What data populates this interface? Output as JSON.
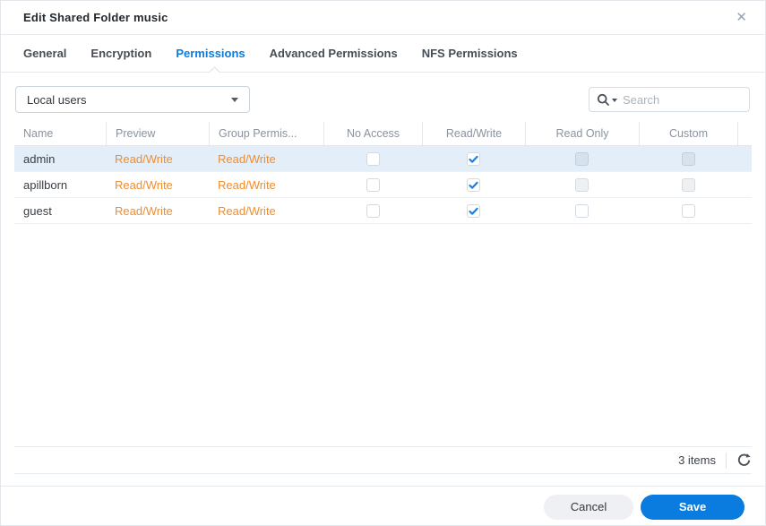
{
  "dialog": {
    "title": "Edit Shared Folder music",
    "close_icon": "✕"
  },
  "tabs": [
    {
      "label": "General",
      "active": false
    },
    {
      "label": "Encryption",
      "active": false
    },
    {
      "label": "Permissions",
      "active": true
    },
    {
      "label": "Advanced Permissions",
      "active": false
    },
    {
      "label": "NFS Permissions",
      "active": false
    }
  ],
  "toolbar": {
    "user_type_select": {
      "value": "Local users",
      "icon": "caret-down-icon"
    },
    "search": {
      "placeholder": "Search",
      "icon": "magnifier-icon",
      "filter_icon": "caret-down-icon"
    }
  },
  "table": {
    "columns": [
      "Name",
      "Preview",
      "Group Permis...",
      "No Access",
      "Read/Write",
      "Read Only",
      "Custom"
    ],
    "rows": [
      {
        "name": "admin",
        "preview": "Read/Write",
        "group_permissions": "Read/Write",
        "no_access": "unchecked",
        "read_write": "checked",
        "read_only": "disabled",
        "custom": "disabled",
        "selected": true
      },
      {
        "name": "apillborn",
        "preview": "Read/Write",
        "group_permissions": "Read/Write",
        "no_access": "unchecked",
        "read_write": "checked",
        "read_only": "disabled",
        "custom": "disabled",
        "selected": false
      },
      {
        "name": "guest",
        "preview": "Read/Write",
        "group_permissions": "Read/Write",
        "no_access": "unchecked",
        "read_write": "checked",
        "read_only": "unchecked",
        "custom": "unchecked",
        "selected": false
      }
    ]
  },
  "statusbar": {
    "items_count": "3 items",
    "refresh_icon": "refresh-icon"
  },
  "footer": {
    "cancel_label": "Cancel",
    "save_label": "Save"
  },
  "colors": {
    "accent_blue": "#0a7ce0",
    "link_orange": "#ef8e2e",
    "selected_row": "#e4eef9",
    "checkmark_blue": "#1b7ce2"
  }
}
